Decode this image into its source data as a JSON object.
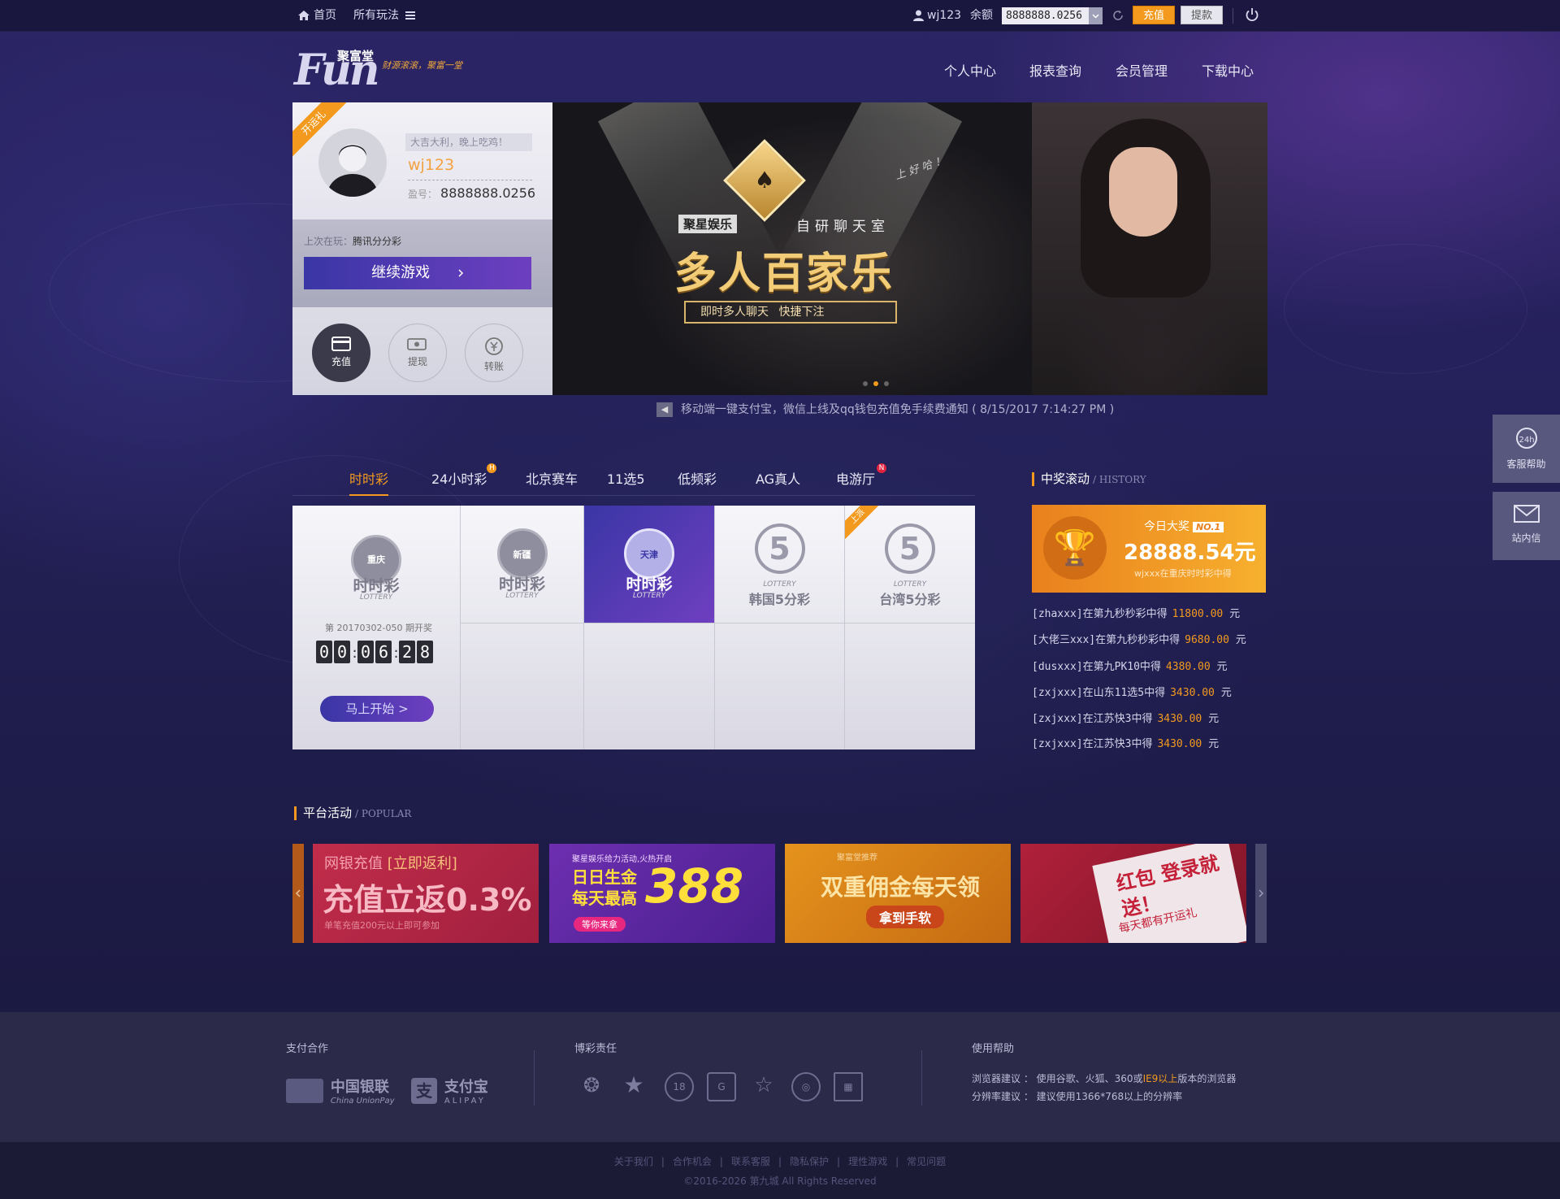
{
  "topbar": {
    "home": "首页",
    "all_games": "所有玩法",
    "username": "wj123",
    "balance_label": "余额",
    "balance_value": "8888888.0256",
    "recharge": "充值",
    "withdraw": "提款"
  },
  "header": {
    "logo_text": "Fun",
    "logo_cn": "聚富堂",
    "slogan": "财源滚滚，聚富一堂",
    "nav": [
      "个人中心",
      "报表查询",
      "会员管理",
      "下载中心"
    ]
  },
  "user_card": {
    "ribbon": "开运礼",
    "greeting": "大吉大利，晚上吃鸡！",
    "username": "wj123",
    "balance_label": "盈号：",
    "balance_value": "8888888.0256",
    "last_play_label": "上次在玩：",
    "last_play_game": "腾讯分分彩",
    "continue_button": "继续游戏",
    "actions": [
      "充值",
      "提现",
      "转账"
    ]
  },
  "banner": {
    "brand": "聚星娱乐",
    "chatroom": "自研聊天室",
    "title": "多人百家乐",
    "feature_1": "即时多人聊天",
    "feature_2": "快捷下注",
    "slogan": "上 好 哈 ！",
    "slides": 3,
    "active_slide": 2
  },
  "notice": {
    "text": "移动端一键支付宝，微信上线及qq钱包充值免手续费通知 ( 8/15/2017 7:14:27 PM )"
  },
  "game_tabs": [
    {
      "label": "时时彩",
      "active": true,
      "badge": ""
    },
    {
      "label": "24小时彩",
      "active": false,
      "badge": "H"
    },
    {
      "label": "北京赛车",
      "active": false,
      "badge": ""
    },
    {
      "label": "11选5",
      "active": false,
      "badge": ""
    },
    {
      "label": "低频彩",
      "active": false,
      "badge": ""
    },
    {
      "label": "AG真人",
      "active": false,
      "badge": ""
    },
    {
      "label": "电游厅",
      "active": false,
      "badge": "N"
    }
  ],
  "games": {
    "featured": {
      "region": "重庆",
      "name": "时时彩",
      "lottery": "LOTTERY",
      "issue": "第 20170302-050 期开奖",
      "countdown": [
        "0",
        "0",
        "0",
        "6",
        "2",
        "8"
      ],
      "start_button": "马上开始 >"
    },
    "items": [
      {
        "region": "新疆",
        "name": "时时彩",
        "lottery": "LOTTERY",
        "active": false,
        "hot": false
      },
      {
        "region": "天津",
        "name": "时时彩",
        "lottery": "LOTTERY",
        "active": true,
        "hot": false
      },
      {
        "region": "5",
        "name": "韩国5分彩",
        "lottery": "LOTTERY",
        "active": false,
        "hot": false
      },
      {
        "region": "5",
        "name": "台湾5分彩",
        "lottery": "LOTTERY",
        "active": false,
        "hot": true,
        "hot_label": "上派"
      }
    ]
  },
  "history": {
    "title": "中奖滚动",
    "subtitle": "/ HISTORY",
    "jackpot_label": "今日大奖",
    "jackpot_rank": "NO.1",
    "jackpot_amount": "28888.54元",
    "jackpot_sub": "wjxxx在重庆时时彩中得",
    "entries": [
      {
        "text": "[zhaxxx]在第九秒秒彩中得",
        "amount": "11800.00",
        "unit": "元"
      },
      {
        "text": "[大佬三xxx]在第九秒秒彩中得",
        "amount": "9680.00",
        "unit": "元"
      },
      {
        "text": "[dusxxx]在第九PK10中得",
        "amount": "4380.00",
        "unit": "元"
      },
      {
        "text": "[zxjxxx]在山东11选5中得",
        "amount": "3430.00",
        "unit": "元"
      },
      {
        "text": "[zxjxxx]在江苏快3中得",
        "amount": "3430.00",
        "unit": "元"
      },
      {
        "text": "[zxjxxx]在江苏快3中得",
        "amount": "3430.00",
        "unit": "元"
      }
    ]
  },
  "popular": {
    "title": "平台活动",
    "subtitle": "/ POPULAR",
    "promos": [
      {
        "tag": "网银充值",
        "tag2": "[立即返利]",
        "headline": "充值立返0.3%",
        "note": "单笔充值200元以上即可参加"
      },
      {
        "tag": "聚星娱乐给力活动,火热开启",
        "headline": "日日生金 每天最高",
        "big": "388",
        "note": "等你来拿"
      },
      {
        "tag": "聚富堂推荐",
        "headline": "双重佣金每天领",
        "note": "拿到手软"
      },
      {
        "tag": "",
        "headline": "红包 登录就送！",
        "note": "每天都有开运礼"
      }
    ]
  },
  "sidebar": {
    "service": "客服帮助",
    "service_icon": "24h",
    "mail": "站内信"
  },
  "footer": {
    "payment_title": "支付合作",
    "payments": [
      "中国银联",
      "支付宝"
    ],
    "payment_sub": [
      "China UnionPay",
      "ALIPAY"
    ],
    "responsibility_title": "博彩责任",
    "responsibility_icons": [
      "18"
    ],
    "help_title": "使用帮助",
    "browser_label": "浏览器建议 ：",
    "browser_text_1": "使用谷歌、火狐、360或",
    "browser_highlight": "IE9以上",
    "browser_text_2": "版本的浏览器",
    "resolution_label": "分辨率建议 ：",
    "resolution_text": "建议使用1366*768以上的分辨率",
    "links": [
      "关于我们",
      "合作机会",
      "联系客服",
      "隐私保护",
      "理性游戏",
      "常见问题"
    ],
    "copyright": "©2016-2026 第九城 All Rights Reserved"
  },
  "colors": {
    "accent": "#f39a1e",
    "purple": "#5a3cb4",
    "bg": "#1d1c47"
  }
}
